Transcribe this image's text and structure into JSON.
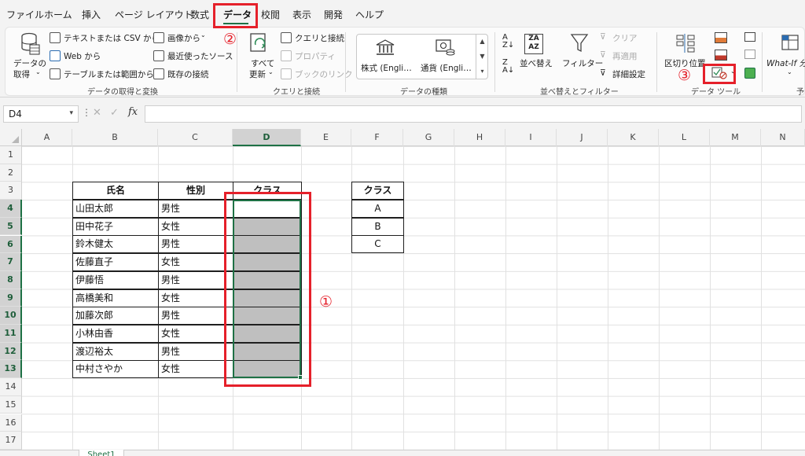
{
  "menu": {
    "items": [
      "ファイル",
      "ホーム",
      "挿入",
      "ページ レイアウト",
      "数式",
      "データ",
      "校閲",
      "表示",
      "開発",
      "ヘルプ"
    ],
    "active": "データ"
  },
  "ribbon": {
    "get_transform": {
      "get_data_l1": "データの",
      "get_data_l2": "取得",
      "from_text_csv": "テキストまたは CSV から",
      "from_web": "Web から",
      "from_table": "テーブルまたは範囲から",
      "from_picture": "画像から",
      "recent_sources": "最近使ったソース",
      "existing_connections": "既存の接続",
      "label": "データの取得と変換"
    },
    "queries": {
      "refresh_all_l1": "すべて",
      "refresh_all_l2": "更新",
      "queries_connections": "クエリと接続",
      "properties": "プロパティ",
      "edit_links": "ブックのリンク",
      "label": "クエリと接続"
    },
    "data_types": {
      "stocks": "株式 (Engli…",
      "currencies": "通貨 (Engli…",
      "label": "データの種類"
    },
    "sort_filter": {
      "sort": "並べ替え",
      "filter": "フィルター",
      "clear": "クリア",
      "reapply": "再適用",
      "advanced": "詳細設定",
      "label": "並べ替えとフィルター"
    },
    "data_tools": {
      "text_to_columns": "区切り位置",
      "label": "データ ツール"
    },
    "forecast": {
      "whatif": "What-If 分",
      "label": "予"
    }
  },
  "formula_bar": {
    "name_box": "D4",
    "fx": "fx",
    "value": ""
  },
  "grid": {
    "columns": [
      "A",
      "B",
      "C",
      "D",
      "E",
      "F",
      "G",
      "H",
      "I",
      "J",
      "K",
      "L",
      "M",
      "N"
    ],
    "rows": [
      "1",
      "2",
      "3",
      "4",
      "5",
      "6",
      "7",
      "8",
      "9",
      "10",
      "11",
      "12",
      "13",
      "14",
      "15",
      "16",
      "17"
    ],
    "selected_column": "D",
    "selected_rows": [
      "4",
      "5",
      "6",
      "7",
      "8",
      "9",
      "10",
      "11",
      "12",
      "13"
    ]
  },
  "main_table": {
    "headers": [
      "氏名",
      "性別",
      "クラス"
    ],
    "rows": [
      [
        "山田太郎",
        "男性",
        ""
      ],
      [
        "田中花子",
        "女性",
        ""
      ],
      [
        "鈴木健太",
        "男性",
        ""
      ],
      [
        "佐藤直子",
        "女性",
        ""
      ],
      [
        "伊藤悟",
        "男性",
        ""
      ],
      [
        "高橋美和",
        "女性",
        ""
      ],
      [
        "加藤次郎",
        "男性",
        ""
      ],
      [
        "小林由香",
        "女性",
        ""
      ],
      [
        "渡辺裕太",
        "男性",
        ""
      ],
      [
        "中村さやか",
        "女性",
        ""
      ]
    ]
  },
  "class_table": {
    "header": "クラス",
    "values": [
      "A",
      "B",
      "C"
    ]
  },
  "annotations": {
    "step1": "①",
    "step2": "②",
    "step3": "③",
    "color": "#e5202a"
  },
  "sheet_tab": "Sheet1",
  "colors": {
    "accent": "#1e7145",
    "range_fill": "#bfbfbf"
  }
}
